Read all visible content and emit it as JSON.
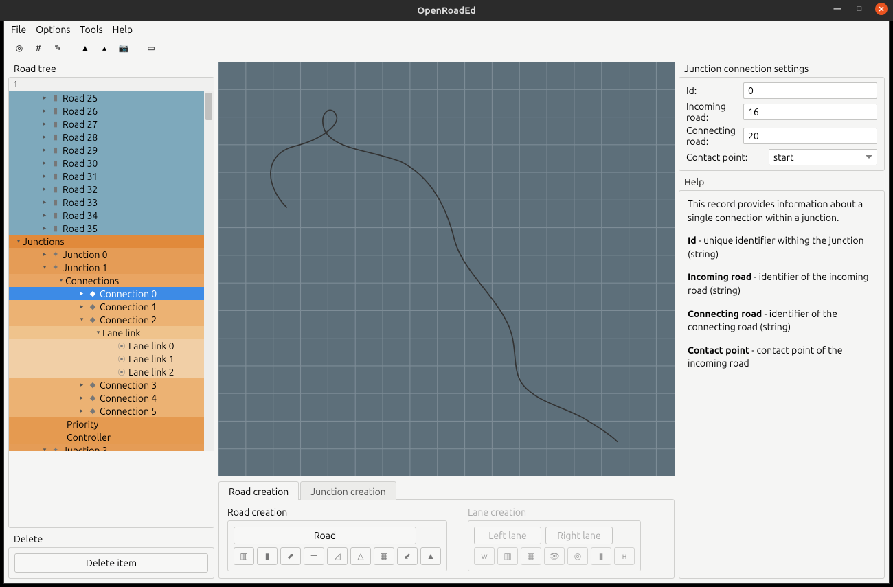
{
  "window": {
    "title": "OpenRoadEd"
  },
  "menu": {
    "file": "File",
    "options": "Options",
    "tools": "Tools",
    "help": "Help"
  },
  "left": {
    "tree_label": "Road tree",
    "tree_header": "1",
    "roads": [
      "Road 25",
      "Road 26",
      "Road 27",
      "Road 28",
      "Road 29",
      "Road 30",
      "Road 31",
      "Road 32",
      "Road 33",
      "Road 34",
      "Road 35"
    ],
    "junctions_label": "Junctions",
    "junction0": "Junction 0",
    "junction1": "Junction 1",
    "connections_label": "Connections",
    "connections": [
      "Connection 0",
      "Connection 1",
      "Connection 2",
      "Connection 3",
      "Connection 4",
      "Connection 5"
    ],
    "lanelink_label": "Lane link",
    "lanelinks": [
      "Lane link 0",
      "Lane link 1",
      "Lane link 2"
    ],
    "priority": "Priority",
    "controller": "Controller",
    "junction2": "Junction 2",
    "delete_label": "Delete",
    "delete_btn": "Delete item"
  },
  "bottom": {
    "tab_road": "Road creation",
    "tab_junction": "Junction creation",
    "road_section": "Road creation",
    "lane_section": "Lane creation",
    "road_btn": "Road",
    "left_lane": "Left lane",
    "right_lane": "Right lane"
  },
  "settings": {
    "title": "Junction connection settings",
    "id_label": "Id:",
    "id_value": "0",
    "incoming_label": "Incoming road:",
    "incoming_value": "16",
    "connecting_label": "Connecting road:",
    "connecting_value": "20",
    "contact_label": "Contact point:",
    "contact_value": "start"
  },
  "help": {
    "title": "Help",
    "intro": "This record provides information about a single connection within a junction.",
    "id_b": "Id",
    "id_t": " - unique identifier withing the junction (string)",
    "in_b": "Incoming road",
    "in_t": " - identifier of the incoming road (string)",
    "cn_b": "Connecting road",
    "cn_t": " - identifier of the connecting road (string)",
    "cp_b": "Contact point",
    "cp_t": " - contact point of the incoming road"
  }
}
